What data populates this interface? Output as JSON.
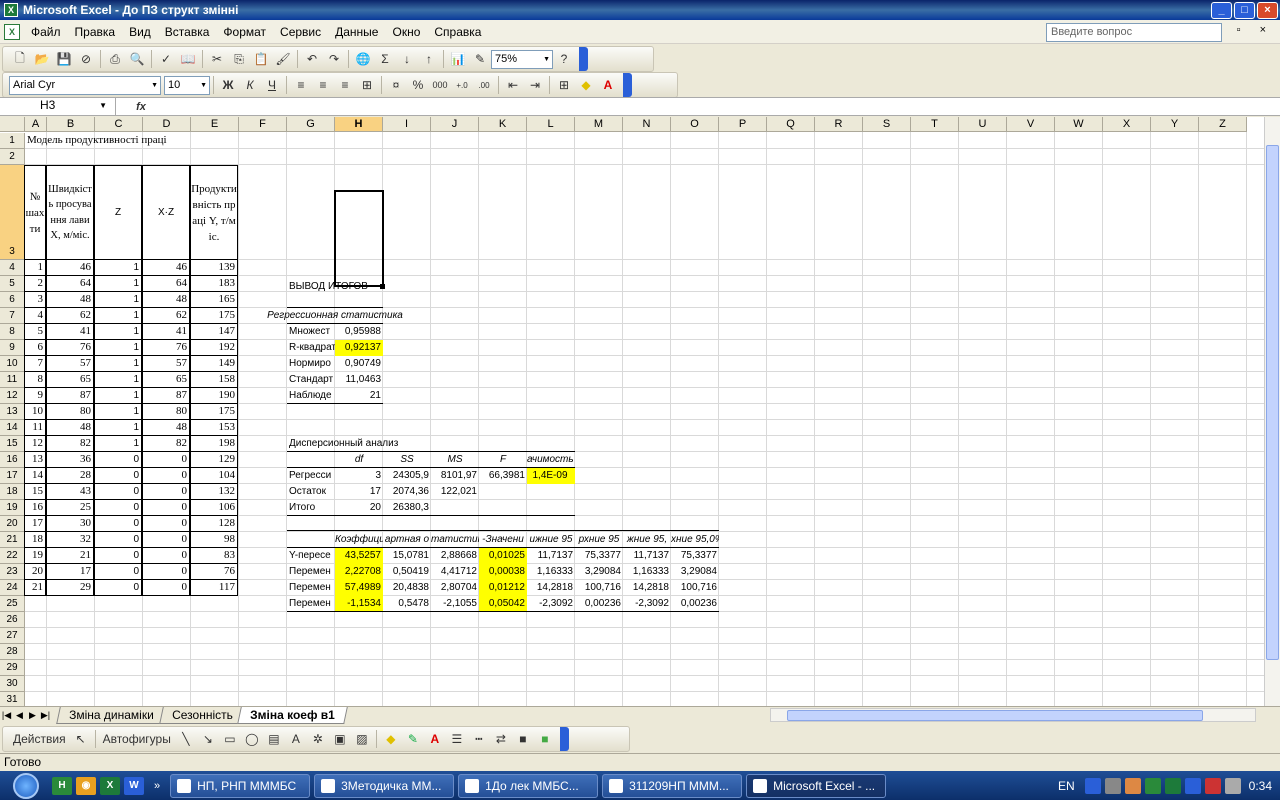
{
  "window": {
    "title": "Microsoft Excel - До ПЗ структ змінні",
    "controls": [
      "_",
      "□",
      "×"
    ]
  },
  "menu": {
    "items": [
      "Файл",
      "Правка",
      "Вид",
      "Вставка",
      "Формат",
      "Сервис",
      "Данные",
      "Окно",
      "Справка"
    ],
    "help_placeholder": "Введите вопрос",
    "mdi": "_ ▫ ×"
  },
  "toolbar": {
    "zoom": "75%",
    "font": "Arial Cyr",
    "size": "10"
  },
  "formula": {
    "cell": "H3",
    "fx": "fx",
    "value": ""
  },
  "columns": [
    "A",
    "B",
    "C",
    "D",
    "E",
    "F",
    "G",
    "H",
    "I",
    "J",
    "K",
    "L",
    "M",
    "N",
    "O",
    "P",
    "Q",
    "R",
    "S",
    "T",
    "U",
    "V",
    "W",
    "X",
    "Y",
    "Z"
  ],
  "rows": [
    "1",
    "2",
    "3",
    "4",
    "5",
    "6",
    "7",
    "8",
    "9",
    "10",
    "11",
    "12",
    "13",
    "14",
    "15",
    "16",
    "17",
    "18",
    "19",
    "20",
    "21",
    "22",
    "23",
    "24",
    "25",
    "26",
    "27",
    "28",
    "29",
    "30",
    "31",
    "32",
    "33"
  ],
  "sheet": {
    "title": "Модель продуктивності праці",
    "hdr_a": "№ шахти",
    "hdr_b": "Швидкість просування лави X, м/міс.",
    "hdr_c": "Z",
    "hdr_d": "X·Z",
    "hdr_e": "Продуктивність праці Y, т/міс.",
    "data": [
      [
        "1",
        "46",
        "1",
        "46",
        "139"
      ],
      [
        "2",
        "64",
        "1",
        "64",
        "183"
      ],
      [
        "3",
        "48",
        "1",
        "48",
        "165"
      ],
      [
        "4",
        "62",
        "1",
        "62",
        "175"
      ],
      [
        "5",
        "41",
        "1",
        "41",
        "147"
      ],
      [
        "6",
        "76",
        "1",
        "76",
        "192"
      ],
      [
        "7",
        "57",
        "1",
        "57",
        "149"
      ],
      [
        "8",
        "65",
        "1",
        "65",
        "158"
      ],
      [
        "9",
        "87",
        "1",
        "87",
        "190"
      ],
      [
        "10",
        "80",
        "1",
        "80",
        "175"
      ],
      [
        "11",
        "48",
        "1",
        "48",
        "153"
      ],
      [
        "12",
        "82",
        "1",
        "82",
        "198"
      ],
      [
        "13",
        "36",
        "0",
        "0",
        "129"
      ],
      [
        "14",
        "28",
        "0",
        "0",
        "104"
      ],
      [
        "15",
        "43",
        "0",
        "0",
        "132"
      ],
      [
        "16",
        "25",
        "0",
        "0",
        "106"
      ],
      [
        "17",
        "30",
        "0",
        "0",
        "128"
      ],
      [
        "18",
        "32",
        "0",
        "0",
        "98"
      ],
      [
        "19",
        "21",
        "0",
        "0",
        "83"
      ],
      [
        "20",
        "17",
        "0",
        "0",
        "76"
      ],
      [
        "21",
        "29",
        "0",
        "0",
        "117"
      ]
    ]
  },
  "regression": {
    "title": "ВЫВОД ИТОГОВ",
    "stat_title": "Регрессионная статистика",
    "stats": [
      [
        "Множест",
        "0,95988"
      ],
      [
        "R-квадрат",
        "0,92137"
      ],
      [
        "Нормиро",
        "0,90749"
      ],
      [
        "Стандарт",
        "11,0463"
      ],
      [
        "Наблюде",
        "21"
      ]
    ],
    "anova_title": "Дисперсионный анализ",
    "anova_hdr": [
      "df",
      "SS",
      "MS",
      "F",
      "ачимость F"
    ],
    "anova": [
      [
        "Регресси",
        "3",
        "24305,9",
        "8101,97",
        "66,3981",
        "1,4E-09"
      ],
      [
        "Остаток",
        "17",
        "2074,36",
        "122,021",
        "",
        ""
      ],
      [
        "Итого",
        "20",
        "26380,3",
        "",
        "",
        ""
      ]
    ],
    "coef_hdr": [
      "Коэффициен",
      "артная о",
      "татистик",
      "-Значени",
      "ижние 95",
      "рхние 95",
      "жние 95,",
      "хние 95,0%"
    ],
    "coef": [
      [
        "Y-пересе",
        "43,5257",
        "15,0781",
        "2,88668",
        "0,01025",
        "11,7137",
        "75,3377",
        "11,7137",
        "75,3377"
      ],
      [
        "Перемен",
        "2,22708",
        "0,50419",
        "4,41712",
        "0,00038",
        "1,16333",
        "3,29084",
        "1,16333",
        "3,29084"
      ],
      [
        "Перемен",
        "57,4989",
        "20,4838",
        "2,80704",
        "0,01212",
        "14,2818",
        "100,716",
        "14,2818",
        "100,716"
      ],
      [
        "Перемен",
        "-1,1534",
        "0,5478",
        "-2,1055",
        "0,05042",
        "-2,3092",
        "0,00236",
        "-2,3092",
        "0,00236"
      ]
    ]
  },
  "tabs": [
    "Зміна динаміки",
    "Сезонність",
    "Зміна коеф в1"
  ],
  "drawing": {
    "actions": "Действия",
    "autoshapes": "Автофигуры"
  },
  "status": "Готово",
  "taskbar": {
    "tasks": [
      "НП, РНП МММБС",
      "3Методичка ММ...",
      "1До лек ММБС...",
      "311209НП МММ...",
      "Microsoft Excel - ..."
    ],
    "lang": "EN",
    "time": "0:34"
  }
}
